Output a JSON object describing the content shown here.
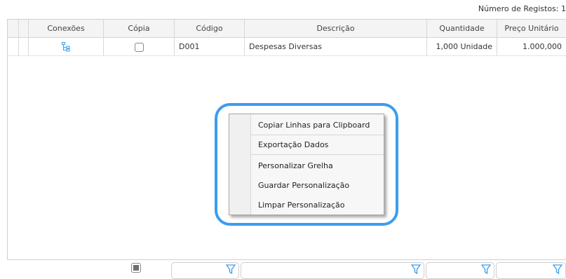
{
  "record_count": {
    "label": "Número de Registos: 1"
  },
  "grid": {
    "columns": [
      "Conexões",
      "Cópia",
      "Código",
      "Descrição",
      "Quantidade",
      "Preço Unitário"
    ],
    "rows": [
      {
        "connections_icon": "tree-structure-icon",
        "copy_checked": false,
        "code": "D001",
        "description": "Despesas Diversas",
        "quantity": "1,000 Unidade",
        "unit_price": "1.000,000"
      }
    ]
  },
  "context_menu": {
    "items": [
      "Copiar Linhas para Clipboard",
      "Exportação Dados",
      "Personalizar Grelha",
      "Guardar Personalização",
      "Limpar Personalização"
    ]
  },
  "colors": {
    "highlight": "#3a9df0",
    "icon_blue": "#3a9df0"
  }
}
